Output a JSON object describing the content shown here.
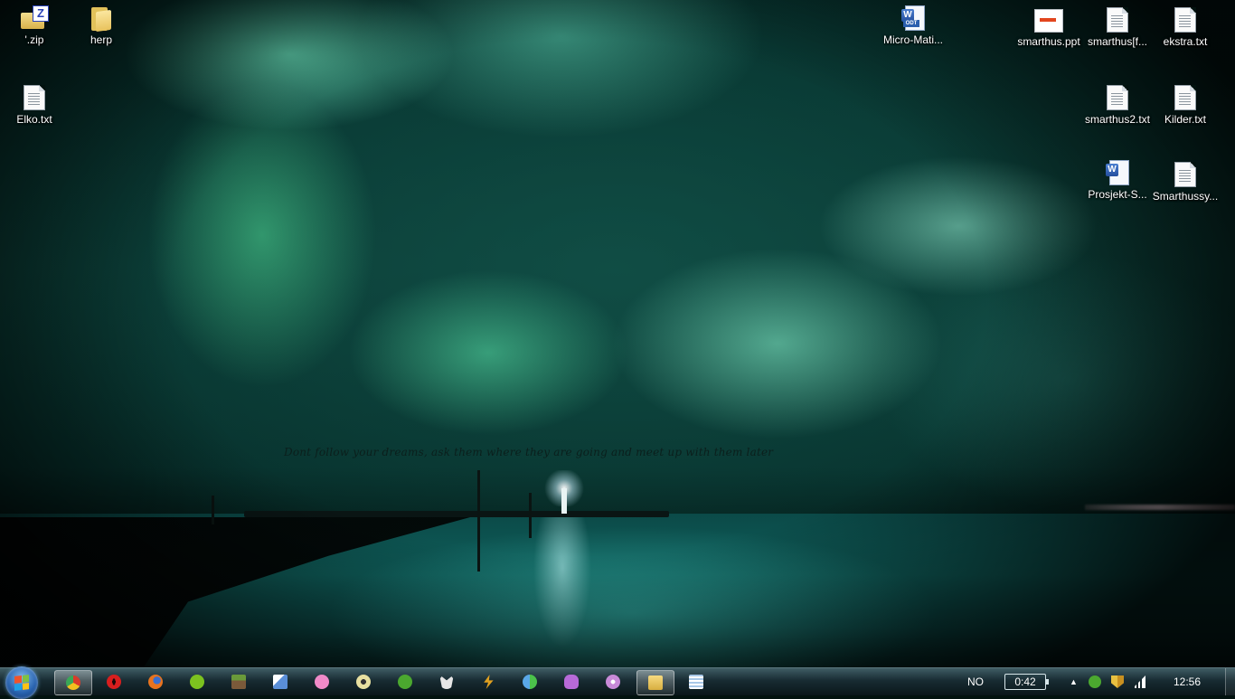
{
  "wallpaper": {
    "quote": "Dont follow your dreams, ask them where they are going and meet up with them later"
  },
  "desktop": {
    "icons": [
      {
        "label": "'.zip",
        "icon": "zip-archive-icon"
      },
      {
        "label": "herp",
        "icon": "folder-icon"
      },
      {
        "label": "Elko.txt",
        "icon": "text-file-icon"
      },
      {
        "label": "Micro-Mati...",
        "icon": "odt-document-icon"
      },
      {
        "label": "smarthus.ppt",
        "icon": "presentation-icon"
      },
      {
        "label": "smarthus[f...",
        "icon": "text-file-icon"
      },
      {
        "label": "ekstra.txt",
        "icon": "text-file-icon"
      },
      {
        "label": "smarthus2.txt",
        "icon": "text-file-icon"
      },
      {
        "label": "Kilder.txt",
        "icon": "text-file-icon"
      },
      {
        "label": "Prosjekt-S...",
        "icon": "word-document-icon"
      },
      {
        "label": "Smarthussy...",
        "icon": "text-file-icon"
      }
    ]
  },
  "taskbar": {
    "start": "start-button",
    "pinned": [
      {
        "name": "chrome",
        "color": "#e8b92a"
      },
      {
        "name": "opera",
        "color": "#d81e1e"
      },
      {
        "name": "firefox",
        "color": "#e8731e"
      },
      {
        "name": "spotify",
        "color": "#7cc21f"
      },
      {
        "name": "minecraft",
        "color": "#6a9a3a"
      },
      {
        "name": "notepad-plus",
        "color": "#5a8fd8"
      },
      {
        "name": "pink-app",
        "color": "#f08ac8"
      },
      {
        "name": "media-player",
        "color": "#e8e0a0"
      },
      {
        "name": "utorrent",
        "color": "#4ba82f"
      },
      {
        "name": "steam-like",
        "color": "#e6e6e6"
      },
      {
        "name": "winamp",
        "color": "#e0a020"
      },
      {
        "name": "live-messenger",
        "color": "#5aa8e8"
      },
      {
        "name": "game-app",
        "color": "#b86ad8"
      },
      {
        "name": "itunes-like",
        "color": "#c88ad8"
      },
      {
        "name": "explorer",
        "color": "#e8c060"
      },
      {
        "name": "notepad",
        "color": "#a8c8e8"
      }
    ],
    "language": "NO",
    "battery": "0:42",
    "clock": "12:56"
  }
}
